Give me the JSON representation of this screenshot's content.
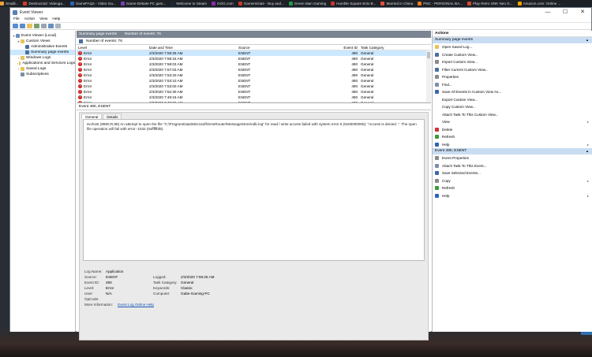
{
  "bookmarks": [
    {
      "label": "Smalli...",
      "color": "#e8a33a"
    },
    {
      "label": "Destructoid: Videoga...",
      "color": "#d23b2e"
    },
    {
      "label": "GameFAQs - Video Ga...",
      "color": "#2a64b8"
    },
    {
      "label": "Game-Debate PC gam...",
      "color": "#7b3bb8"
    },
    {
      "label": "Welcome to Steam",
      "color": "#1b2838"
    },
    {
      "label": "GOG.com",
      "color": "#8a2ab0"
    },
    {
      "label": "GamersGate - Buy and...",
      "color": "#c43b2c"
    },
    {
      "label": "Green Man Gaming",
      "color": "#1e9b4f"
    },
    {
      "label": "Humble Square Enix B...",
      "color": "#c7372d"
    },
    {
      "label": "Married in China",
      "color": "#e04e3a"
    },
    {
      "label": "PNC - PERSONAL BA...",
      "color": "#e67a1e"
    },
    {
      "label": "Play Retro SNK Neo G...",
      "color": "#d44a2f"
    },
    {
      "label": "Amazon.com: Online ...",
      "color": "#f0a000"
    }
  ],
  "window": {
    "title": "Event Viewer",
    "menu": [
      "File",
      "Action",
      "View",
      "Help"
    ],
    "min": "—",
    "max": "☐",
    "close": "✕"
  },
  "tree": [
    {
      "label": "Event Viewer (Local)",
      "level": 0,
      "arrow": "▾",
      "color": "#6a8fbf"
    },
    {
      "label": "Custom Views",
      "level": 1,
      "arrow": "▾",
      "color": "#e6c35c"
    },
    {
      "label": "Administrative Events",
      "level": 2,
      "arrow": "",
      "color": "#4a6fa0"
    },
    {
      "label": "Summary page events",
      "level": 2,
      "arrow": "",
      "color": "#4a6fa0",
      "selected": true
    },
    {
      "label": "Windows Logs",
      "level": 1,
      "arrow": "›",
      "color": "#e6c35c"
    },
    {
      "label": "Applications and Services Logs",
      "level": 1,
      "arrow": "›",
      "color": "#e6c35c"
    },
    {
      "label": "Saved Logs",
      "level": 1,
      "arrow": "›",
      "color": "#e6c35c"
    },
    {
      "label": "Subscriptions",
      "level": 1,
      "arrow": "",
      "color": "#7a8fa8"
    }
  ],
  "center": {
    "header_title": "Summary page events",
    "header_count": "Number of events: 76",
    "filter_count": "Number of events: 76",
    "columns": [
      "Level",
      "Date and Time",
      "Source",
      "Event ID",
      "Task Category"
    ],
    "rows": [
      {
        "level": "Error",
        "datetime": "2/3/2020 7:59:25 AM",
        "source": "ESENT",
        "id": "490",
        "category": "General",
        "selected": true
      },
      {
        "level": "Error",
        "datetime": "2/3/2020 7:58:15 AM",
        "source": "ESENT",
        "id": "490",
        "category": "General"
      },
      {
        "level": "Error",
        "datetime": "2/3/2020 7:58:03 AM",
        "source": "ESENT",
        "id": "490",
        "category": "General"
      },
      {
        "level": "Error",
        "datetime": "2/3/2020 7:57:03 AM",
        "source": "ESENT",
        "id": "490",
        "category": "General"
      },
      {
        "level": "Error",
        "datetime": "2/3/2020 7:53:20 AM",
        "source": "ESENT",
        "id": "490",
        "category": "General"
      },
      {
        "level": "Error",
        "datetime": "2/3/2020 7:53:10 AM",
        "source": "ESENT",
        "id": "490",
        "category": "General"
      },
      {
        "level": "Error",
        "datetime": "2/3/2020 7:53:00 AM",
        "source": "ESENT",
        "id": "490",
        "category": "General"
      },
      {
        "level": "Error",
        "datetime": "2/3/2020 7:52:30 AM",
        "source": "ESENT",
        "id": "490",
        "category": "General"
      },
      {
        "level": "Error",
        "datetime": "2/3/2020 7:48:16 AM",
        "source": "ESENT",
        "id": "490",
        "category": "General"
      },
      {
        "level": "Error",
        "datetime": "2/3/2020 7:48:06 AM",
        "source": "ESENT",
        "id": "490",
        "category": "General"
      }
    ],
    "detail_title": "Event 490, ESENT",
    "tabs": [
      "General",
      "Details"
    ],
    "message": "svchost (8960,R,98) An attempt to open the file \"C:\\ProgramData\\Microsoft\\SmsRouter\\MessageStore\\edb.log\" for read / write access failed with system error 5 (0x00000005): \"Access is denied. \". The open file operation will fail with error -1032 (0xfffffbf8).",
    "props": {
      "log_name_label": "Log Name:",
      "log_name": "Application",
      "source_label": "Source:",
      "source": "ESENT",
      "logged_label": "Logged:",
      "logged": "2/3/2020 7:59:25 AM",
      "event_id_label": "Event ID:",
      "event_id": "490",
      "task_label": "Task Category:",
      "task": "General",
      "level_label": "Level:",
      "level": "Error",
      "keywords_label": "Keywords:",
      "keywords": "Classic",
      "user_label": "User:",
      "user": "N/A",
      "computer_label": "Computer:",
      "computer": "Gabe-Gaming-PC",
      "opcode_label": "OpCode:",
      "opcode": "",
      "more_label": "More Information:",
      "more_link": "Event Log Online Help"
    }
  },
  "actions": {
    "title": "Actions",
    "section1": "Summary page events",
    "items1": [
      {
        "label": "Open Saved Log...",
        "color": "#e6c35c"
      },
      {
        "label": "Create Custom View...",
        "color": "#4a6fa0"
      },
      {
        "label": "Import Custom View...",
        "color": "#8a8a8a"
      },
      {
        "label": "Filter Current Custom View...",
        "color": "#4a6fa0"
      },
      {
        "label": "Properties",
        "color": "#8a8a8a"
      },
      {
        "label": "Find...",
        "color": "#7a8fa8"
      },
      {
        "label": "Save All Events in Custom View As...",
        "color": "#3a6aa8"
      },
      {
        "label": "Export Custom View...",
        "color": "#ffffff"
      },
      {
        "label": "Copy Custom View...",
        "color": "#ffffff"
      },
      {
        "label": "Attach Task To This Custom View...",
        "color": "#ffffff"
      },
      {
        "label": "View",
        "color": "#ffffff",
        "sub": true
      },
      {
        "label": "Delete",
        "color": "#d0312d"
      },
      {
        "label": "Refresh",
        "color": "#3a9a3a"
      },
      {
        "label": "Help",
        "color": "#2a64b8",
        "sub": true
      }
    ],
    "section2": "Event 490, ESENT",
    "items2": [
      {
        "label": "Event Properties",
        "color": "#8a8a8a"
      },
      {
        "label": "Attach Task To This Event...",
        "color": "#7a8fa8"
      },
      {
        "label": "Save Selected Events...",
        "color": "#3a6aa8"
      },
      {
        "label": "Copy",
        "color": "#8a8a8a",
        "sub": true
      },
      {
        "label": "Refresh",
        "color": "#3a9a3a"
      },
      {
        "label": "Help",
        "color": "#2a64b8",
        "sub": true
      }
    ]
  }
}
